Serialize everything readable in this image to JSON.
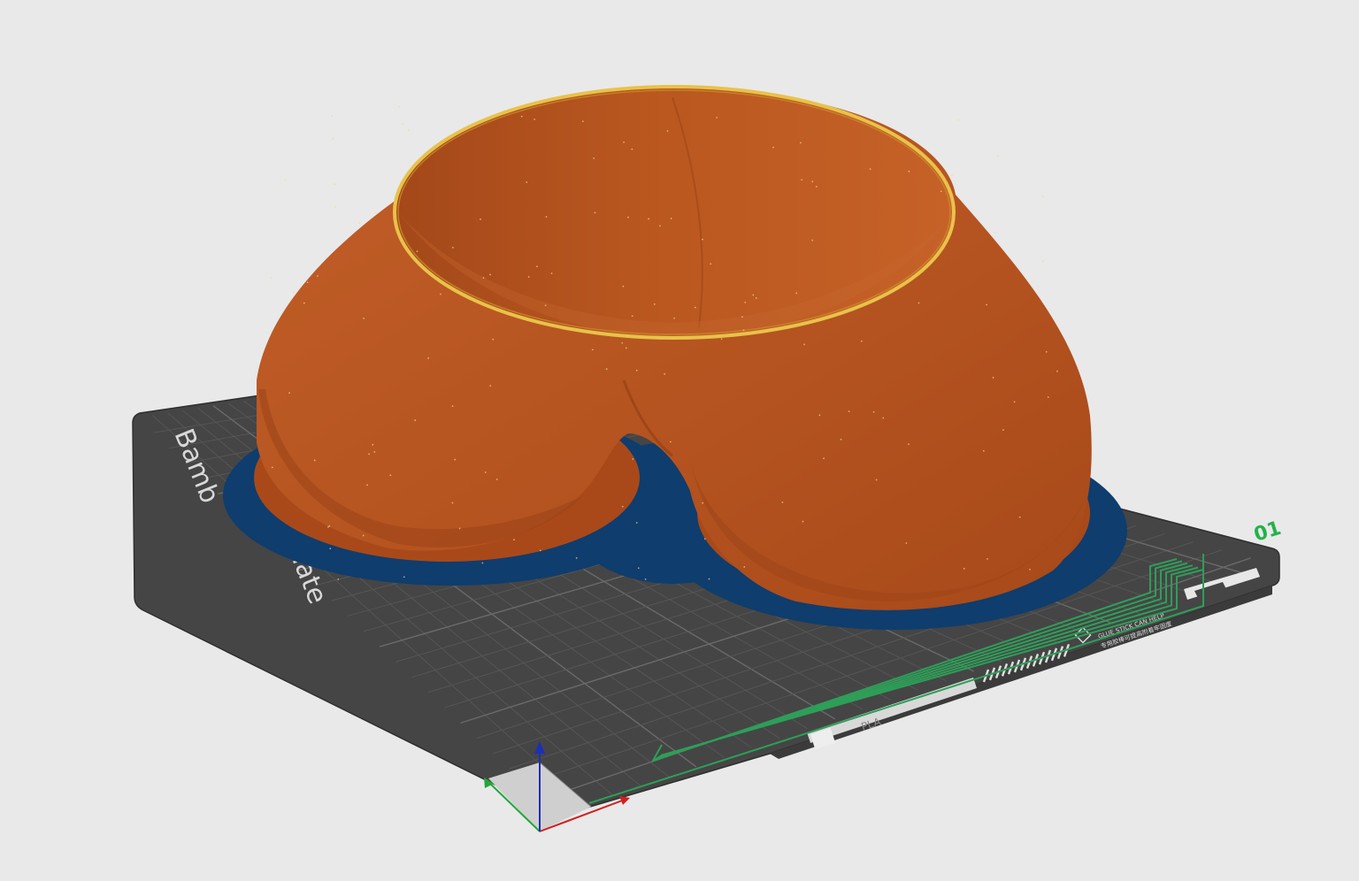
{
  "viewport": {
    "background": "#e9e9e9"
  },
  "plate": {
    "brand_text_1": "Bamb",
    "brand_text_2": "late",
    "plate_number": "01",
    "material_label": "PLA",
    "glue_text_1": "GLUE STICK CAN HELP",
    "glue_text_2": "专用胶棒可提高附着牢固度",
    "plate_color": "#454545",
    "grid_color": "#5a5a5a",
    "number_color": "#21b34a",
    "wipe_lines_color": "#2e9e58"
  },
  "model": {
    "body_color": "#b7531f",
    "brim_color": "#0e3d6e",
    "rim_color": "#e8c24a"
  },
  "axes": {
    "x_color": "#d02020",
    "y_color": "#21a83a",
    "z_color": "#1c2fb8",
    "x_icon": "x-axis-arrow-icon",
    "y_icon": "y-axis-arrow-icon",
    "z_icon": "z-axis-arrow-icon"
  }
}
